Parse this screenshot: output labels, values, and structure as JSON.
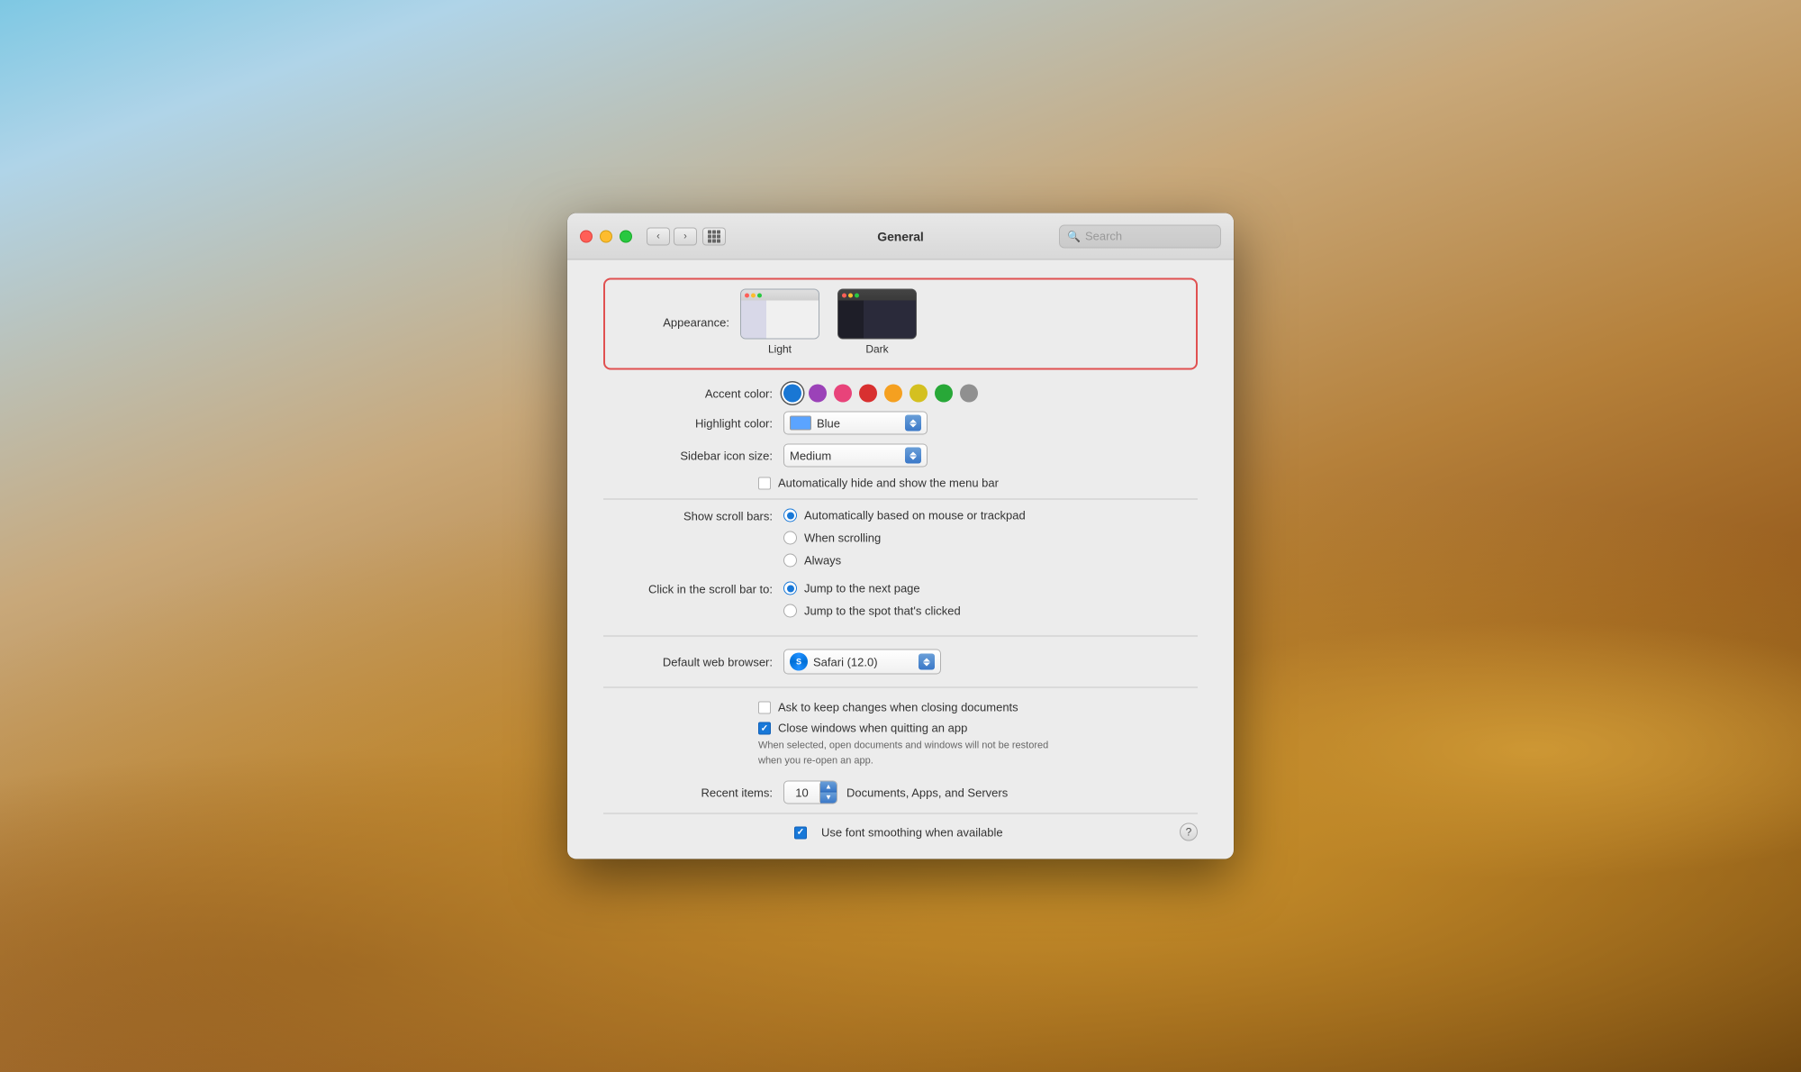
{
  "window": {
    "title": "General",
    "search_placeholder": "Search"
  },
  "appearance": {
    "label": "Appearance:",
    "options": [
      {
        "id": "light",
        "label": "Light"
      },
      {
        "id": "dark",
        "label": "Dark"
      }
    ],
    "selected": "dark"
  },
  "accent_color": {
    "label": "Accent color:",
    "colors": [
      {
        "id": "blue",
        "hex": "#1977d4",
        "selected": true
      },
      {
        "id": "purple",
        "hex": "#9b42b8"
      },
      {
        "id": "pink",
        "hex": "#e8437a"
      },
      {
        "id": "red",
        "hex": "#d83030"
      },
      {
        "id": "orange",
        "hex": "#f5a020"
      },
      {
        "id": "yellow",
        "hex": "#d4c020"
      },
      {
        "id": "green",
        "hex": "#28a838"
      },
      {
        "id": "graphite",
        "hex": "#909090"
      }
    ]
  },
  "highlight_color": {
    "label": "Highlight color:",
    "value": "Blue",
    "swatch": "#5ba4ff"
  },
  "sidebar_icon_size": {
    "label": "Sidebar icon size:",
    "value": "Medium"
  },
  "menu_bar": {
    "label": "",
    "checkbox_label": "Automatically hide and show the menu bar",
    "checked": false
  },
  "show_scroll_bars": {
    "label": "Show scroll bars:",
    "options": [
      {
        "id": "auto",
        "label": "Automatically based on mouse or trackpad",
        "selected": true
      },
      {
        "id": "scrolling",
        "label": "When scrolling",
        "selected": false
      },
      {
        "id": "always",
        "label": "Always",
        "selected": false
      }
    ]
  },
  "click_scroll_bar": {
    "label": "Click in the scroll bar to:",
    "options": [
      {
        "id": "next_page",
        "label": "Jump to the next page",
        "selected": true
      },
      {
        "id": "spot",
        "label": "Jump to the spot that's clicked",
        "selected": false
      }
    ]
  },
  "default_browser": {
    "label": "Default web browser:",
    "value": "Safari (12.0)",
    "icon": "safari"
  },
  "close_windows": {
    "ask_label": "Ask to keep changes when closing documents",
    "ask_checked": false,
    "close_label": "Close windows when quitting an app",
    "close_checked": true,
    "hint": "When selected, open documents and windows will not be restored\nwhen you re-open an app."
  },
  "recent_items": {
    "label": "Recent items:",
    "value": "10",
    "suffix": "Documents, Apps, and Servers"
  },
  "font_smoothing": {
    "label": "Use font smoothing when available",
    "checked": true
  },
  "traffic_lights": {
    "close": "close-button",
    "minimize": "minimize-button",
    "maximize": "maximize-button"
  }
}
